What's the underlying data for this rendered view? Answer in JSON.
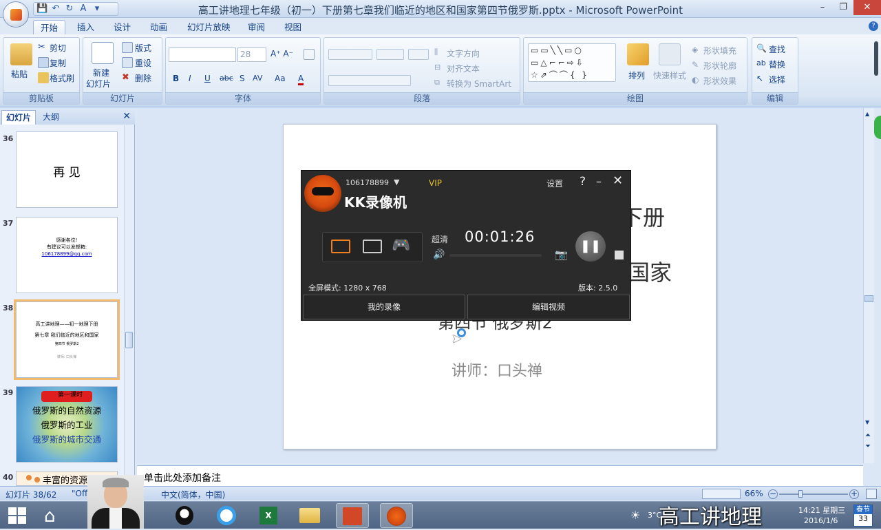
{
  "window": {
    "title": "高工讲地理七年级（初一）下册第七章我们临近的地区和国家第四节俄罗斯.pptx - Microsoft PowerPoint",
    "controls": [
      "–",
      "❐",
      "✕"
    ]
  },
  "ribbon_tabs": [
    "开始",
    "插入",
    "设计",
    "动画",
    "幻灯片放映",
    "审阅",
    "视图"
  ],
  "ribbon": {
    "clipboard": {
      "paste": "粘贴",
      "cut": "剪切",
      "copy": "复制",
      "format_painter": "格式刷",
      "label": "剪贴板"
    },
    "slides": {
      "new_slide_1": "新建",
      "new_slide_2": "幻灯片",
      "layout": "版式",
      "reset": "重设",
      "delete": "删除",
      "label": "幻灯片"
    },
    "font": {
      "size": "28",
      "bold": "B",
      "italic": "I",
      "underline": "U",
      "strike": "abc",
      "shadow": "S",
      "spacing": "AV",
      "case": "Aa",
      "color": "A",
      "label": "字体"
    },
    "paragraph": {
      "direction": "文字方向",
      "align_text": "对齐文本",
      "smartart": "转换为 SmartArt",
      "label": "段落"
    },
    "drawing": {
      "arrange": "排列",
      "quick_styles": "快速样式",
      "fill": "形状填充",
      "outline": "形状轮廓",
      "effects": "形状效果",
      "label": "绘图"
    },
    "editing": {
      "find": "查找",
      "replace": "替换",
      "select": "选择",
      "label": "编辑"
    }
  },
  "slide_panel": {
    "tabs": [
      "幻灯片",
      "大纲"
    ],
    "thumbs": [
      {
        "num": "36",
        "text": "再 见"
      },
      {
        "num": "37",
        "lines": [
          "感谢各位!",
          "有建议可以发邮箱:"
        ],
        "email": "106178899@qq.com"
      },
      {
        "num": "38",
        "lines": [
          "高工讲地理——初一地理下册",
          "第七章 我们临近的地区和国家",
          "第四节 俄罗斯2",
          "讲师: 口头禅"
        ]
      },
      {
        "num": "39",
        "banner": "第一课时",
        "lines": [
          "俄罗斯的自然资源",
          "俄罗斯的工业",
          "俄罗斯的城市交通"
        ]
      },
      {
        "num": "40",
        "text": "丰富的资源"
      }
    ]
  },
  "slide": {
    "line1_visible": "下册",
    "line2_visible": "国家",
    "line3_visible": "第四节 俄罗斯2",
    "lecturer": "讲师：口头禅"
  },
  "notes_placeholder": "单击此处添加备注",
  "status": {
    "slide_count": "幻灯片 38/62",
    "theme": "\"Office",
    "language": "中文(简体，中国)",
    "zoom": "66%"
  },
  "kk": {
    "user_id": "106178899",
    "vip": "VIP",
    "brand": "KK录像机",
    "settings": "设置",
    "quality": "超清",
    "timer": "00:01:26",
    "mode": "全屏模式: 1280 x 768",
    "version": "版本: 2.5.0",
    "my_recordings": "我的录像",
    "edit_video": "编辑视频"
  },
  "taskbar": {
    "temp": "3°C",
    "time": "14:21 星期三",
    "date": "2016/1/6",
    "calendar_top": "春节",
    "calendar_num": "33"
  },
  "watermark": "高工讲地理"
}
